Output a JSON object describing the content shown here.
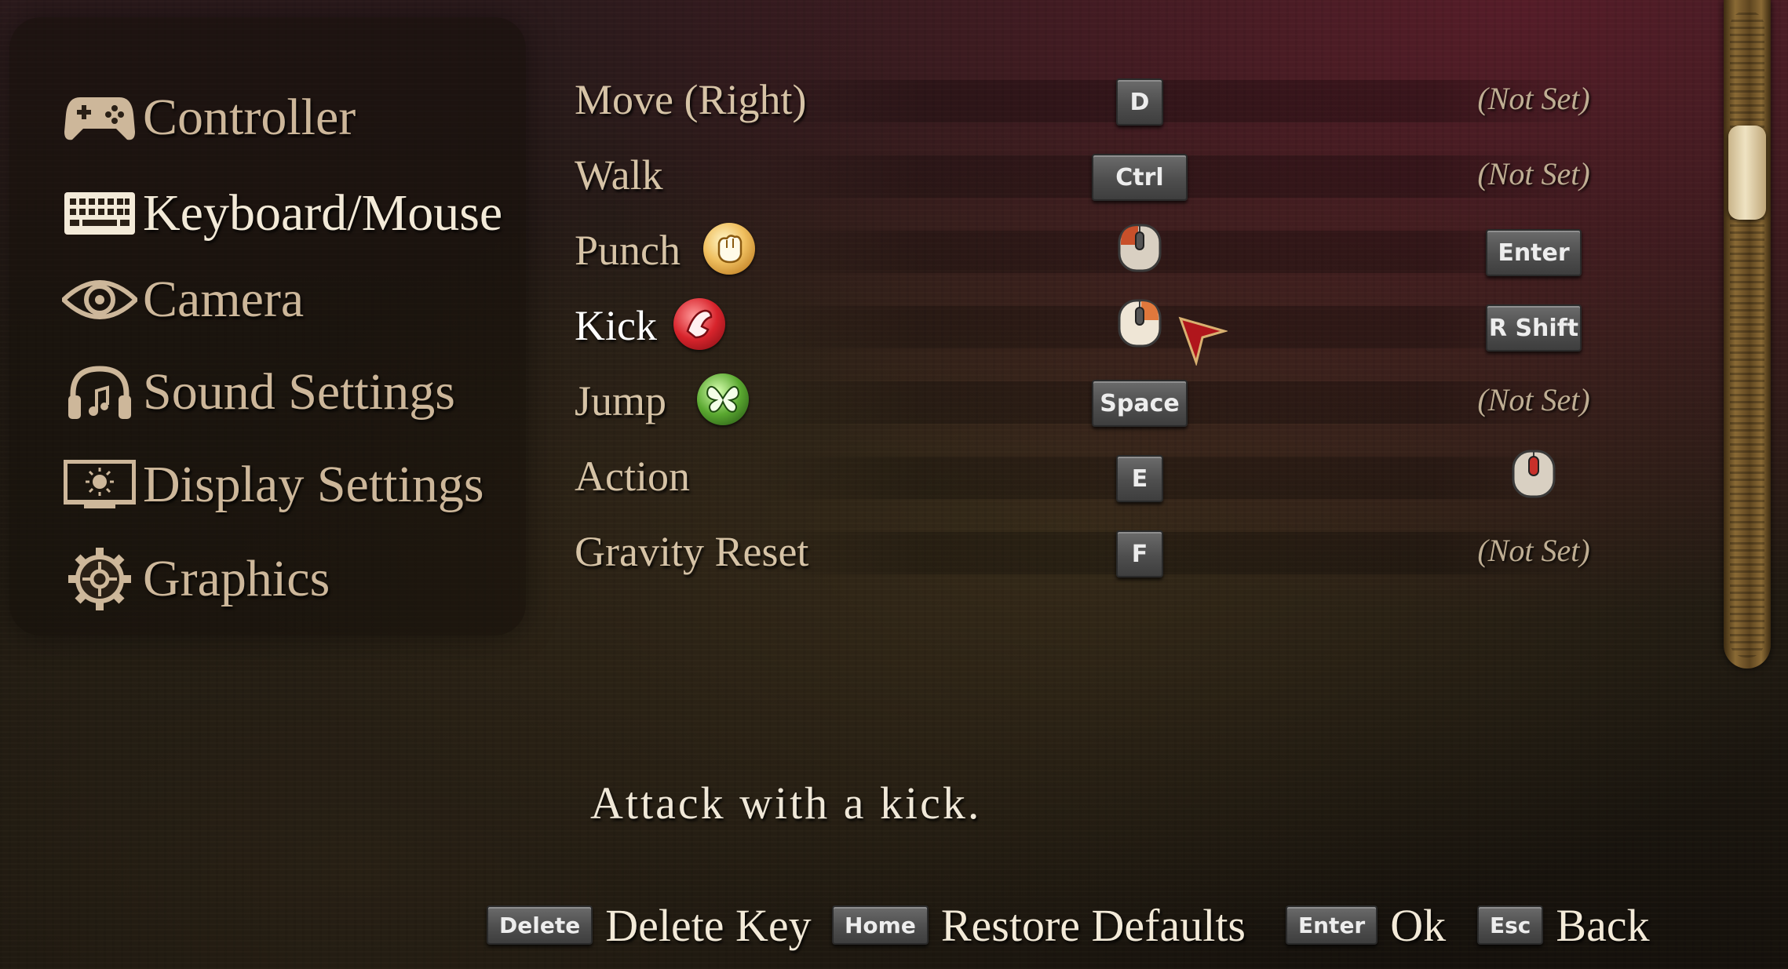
{
  "nav": {
    "items": [
      {
        "label": "Controller",
        "icon": "gamepad-icon"
      },
      {
        "label": "Keyboard/Mouse",
        "icon": "keyboard-icon",
        "active": true
      },
      {
        "label": "Camera",
        "icon": "eye-icon"
      },
      {
        "label": "Sound Settings",
        "icon": "headphones-icon"
      },
      {
        "label": "Display Settings",
        "icon": "monitor-icon"
      },
      {
        "label": "Graphics",
        "icon": "gear-icon"
      }
    ]
  },
  "bindings": [
    {
      "action": "Move (Right)",
      "primary": "D",
      "secondary": "(Not Set)"
    },
    {
      "action": "Walk",
      "primary": "Ctrl",
      "secondary": "(Not Set)"
    },
    {
      "action": "Punch",
      "icon": "fist-icon",
      "primary": "left-mouse-button-icon",
      "secondary": "Enter"
    },
    {
      "action": "Kick",
      "icon": "kick-icon",
      "primary": "right-mouse-button-icon",
      "secondary": "R Shift",
      "selected": true
    },
    {
      "action": "Jump",
      "icon": "butterfly-icon",
      "primary": "Space",
      "secondary": "(Not Set)"
    },
    {
      "action": "Action",
      "primary": "E",
      "secondary": "middle-mouse-button-icon"
    },
    {
      "action": "Gravity Reset",
      "primary": "F",
      "secondary": "(Not Set)"
    }
  ],
  "description": "Attack with a kick.",
  "footer": [
    {
      "key": "Delete",
      "label": "Delete Key"
    },
    {
      "key": "Home",
      "label": "Restore Defaults"
    },
    {
      "key": "Enter",
      "label": "Ok"
    },
    {
      "key": "Esc",
      "label": "Back"
    }
  ],
  "colors": {
    "text": "#d6c3a6",
    "highlight": "#ffffff",
    "keycap": "#555555"
  }
}
